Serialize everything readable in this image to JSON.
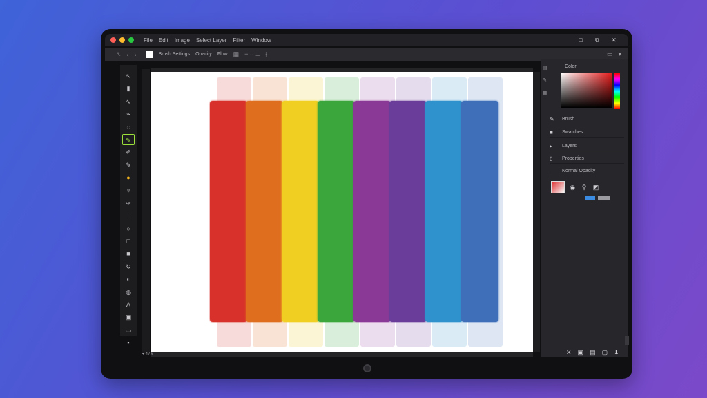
{
  "window": {
    "traffic_lights": [
      "#ff5f57",
      "#febc2e",
      "#28c840"
    ],
    "menu": [
      "File",
      "Edit",
      "Image",
      "Select Layer",
      "Filter",
      "Window"
    ],
    "window_controls": [
      "□",
      "⧉",
      "✕"
    ]
  },
  "options_bar": {
    "icons": [
      "move-arrow-icon",
      "nav-back-icon",
      "nav-forward-icon"
    ],
    "labels": [
      "Brush Settings",
      "Opacity",
      "Flow"
    ],
    "right_icons": [
      "workspace-icon",
      "expand-icon"
    ]
  },
  "tools": [
    {
      "name": "move-tool",
      "glyph": "↖"
    },
    {
      "name": "marquee-tool",
      "glyph": "▮"
    },
    {
      "name": "lasso-tool",
      "glyph": "∿"
    },
    {
      "name": "quick-select-tool",
      "glyph": "⌁"
    },
    {
      "name": "crop-tool",
      "glyph": "◌"
    },
    {
      "name": "brush-tool",
      "glyph": "✎",
      "active": true
    },
    {
      "name": "eyedropper-tool",
      "glyph": "✐"
    },
    {
      "name": "healing-tool",
      "glyph": "✎"
    },
    {
      "name": "fill-tool",
      "glyph": "●",
      "fill": true
    },
    {
      "name": "clone-tool",
      "glyph": "♆"
    },
    {
      "name": "pen-tool",
      "glyph": "✑"
    },
    {
      "name": "line-tool",
      "glyph": "│"
    },
    {
      "name": "ellipse-tool",
      "glyph": "○"
    },
    {
      "name": "rectangle-tool",
      "glyph": "□"
    },
    {
      "name": "foreground-color",
      "glyph": "■"
    },
    {
      "name": "rotate-tool",
      "glyph": "↻"
    },
    {
      "name": "dodge-tool",
      "glyph": "◐"
    },
    {
      "name": "smudge-tool",
      "glyph": "◍"
    },
    {
      "name": "type-tool",
      "glyph": "Ʌ"
    },
    {
      "name": "frame-tool",
      "glyph": "▣"
    },
    {
      "name": "screen-mode-tool",
      "glyph": "▭"
    },
    {
      "name": "extra-tool",
      "glyph": "▪"
    }
  ],
  "canvas": {
    "stripes": [
      {
        "color": "#d8312b",
        "ghost": "#e99b97"
      },
      {
        "color": "#e06e1f",
        "ghost": "#efb08a"
      },
      {
        "color": "#f1cf22",
        "ghost": "#f6e488"
      },
      {
        "color": "#3aa63b",
        "ghost": "#98d29a"
      },
      {
        "color": "#8a3a96",
        "ghost": "#c9a0cf"
      },
      {
        "color": "#6a3d9a",
        "ghost": "#b7a0cd"
      },
      {
        "color": "#2f92cd",
        "ghost": "#98c8e6"
      },
      {
        "color": "#3e6fb8",
        "ghost": "#a2b8dd"
      }
    ],
    "status_text": "▾ 47.6"
  },
  "panels": {
    "color_title": "Color",
    "rows": [
      {
        "icon": "✎",
        "label": "Brush",
        "name": "brush-panel-row"
      },
      {
        "icon": "■",
        "label": "Swatches",
        "name": "swatches-panel-row"
      },
      {
        "icon": "▸",
        "label": "Layers",
        "name": "layers-panel-row"
      },
      {
        "icon": "▯",
        "label": "Properties",
        "name": "properties-panel-row"
      },
      {
        "icon": "",
        "label": "Normal   Opacity",
        "name": "blend-mode-row"
      }
    ],
    "footer_icons": [
      "✕",
      "▣",
      "▤",
      "▢",
      "⬇"
    ]
  },
  "colors": {
    "accent_active_tool": "#9be03b",
    "app_background": "#27272b"
  }
}
